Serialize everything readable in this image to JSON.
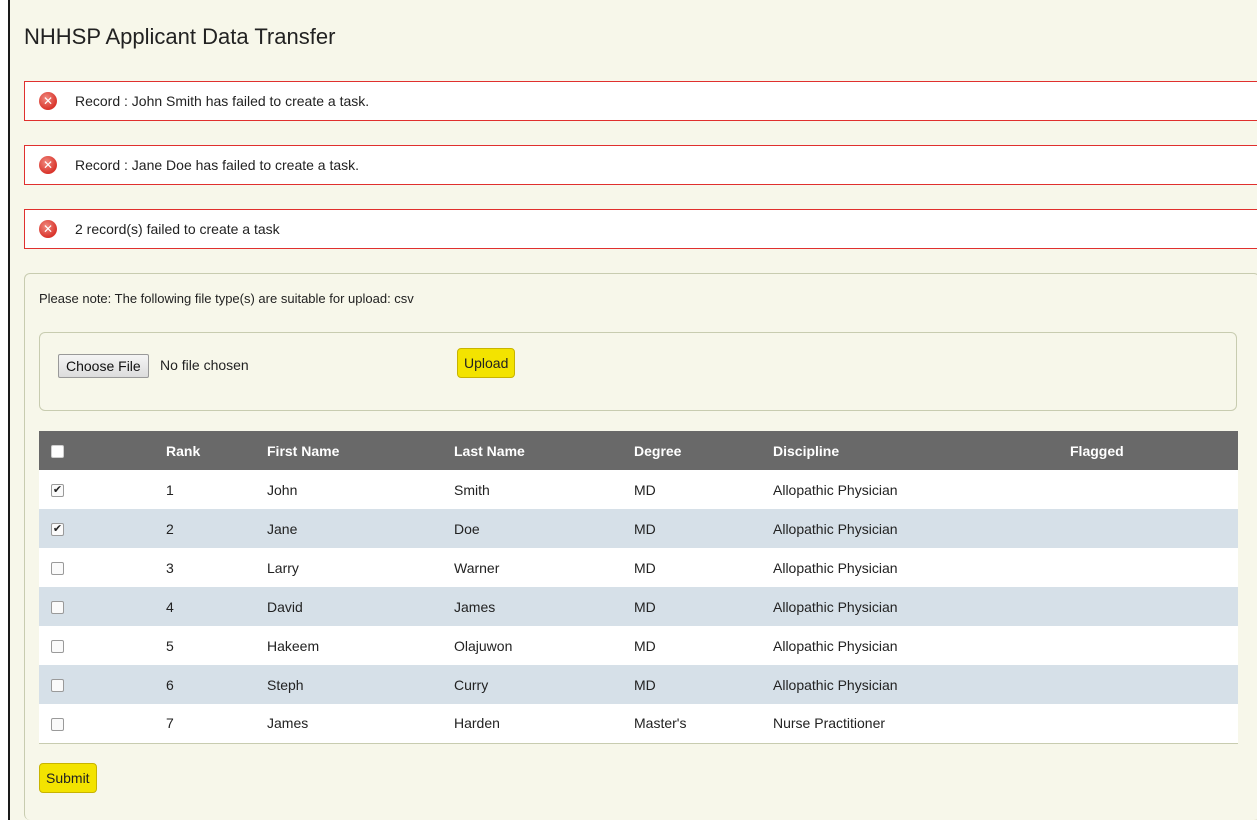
{
  "page": {
    "title": "NHHSP Applicant Data Transfer"
  },
  "errors": [
    "Record : John Smith has failed to create a task.",
    "Record : Jane Doe has failed to create a task.",
    "2 record(s) failed to create a task"
  ],
  "upload": {
    "note": "Please note: The following file type(s) are suitable for upload: csv",
    "choose_label": "Choose File",
    "file_status": "No file chosen",
    "upload_label": "Upload"
  },
  "table": {
    "headers": [
      "Rank",
      "First Name",
      "Last Name",
      "Degree",
      "Discipline",
      "Flagged"
    ],
    "rows": [
      {
        "checked": true,
        "rank": "1",
        "first": "John",
        "last": "Smith",
        "degree": "MD",
        "discipline": "Allopathic Physician",
        "flagged": ""
      },
      {
        "checked": true,
        "rank": "2",
        "first": "Jane",
        "last": "Doe",
        "degree": "MD",
        "discipline": "Allopathic Physician",
        "flagged": ""
      },
      {
        "checked": false,
        "rank": "3",
        "first": "Larry",
        "last": "Warner",
        "degree": "MD",
        "discipline": "Allopathic Physician",
        "flagged": ""
      },
      {
        "checked": false,
        "rank": "4",
        "first": "David",
        "last": "James",
        "degree": "MD",
        "discipline": "Allopathic Physician",
        "flagged": ""
      },
      {
        "checked": false,
        "rank": "5",
        "first": "Hakeem",
        "last": "Olajuwon",
        "degree": "MD",
        "discipline": "Allopathic Physician",
        "flagged": ""
      },
      {
        "checked": false,
        "rank": "6",
        "first": "Steph",
        "last": "Curry",
        "degree": "MD",
        "discipline": "Allopathic Physician",
        "flagged": ""
      },
      {
        "checked": false,
        "rank": "7",
        "first": "James",
        "last": "Harden",
        "degree": "Master's",
        "discipline": "Nurse Practitioner",
        "flagged": ""
      }
    ]
  },
  "submit_label": "Submit",
  "colors": {
    "error_border": "#e0302e",
    "button_yellow": "#f3e300",
    "header_bg": "#696969",
    "row_alt": "#d6e0e8",
    "page_bg": "#f7f7ea"
  }
}
